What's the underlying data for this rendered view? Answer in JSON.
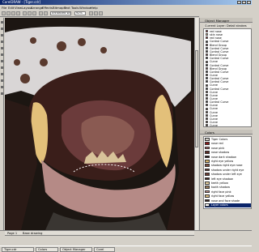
{
  "window": {
    "title": "CorelDRAW - [Tiger.cdr]"
  },
  "menu": [
    "File",
    "Edit",
    "View",
    "Layout",
    "Arrange",
    "Effects",
    "Bitmaps",
    "Text",
    "Tools",
    "Window",
    "Help"
  ],
  "property_bar": {
    "view_mode": "Enhanced Wire",
    "zoom": "92%"
  },
  "object_manager": {
    "title": "Object Manager",
    "layer_header": "Current Layer: Detail strokes",
    "items": [
      {
        "label": "red nose",
        "color": "#8b1a1a"
      },
      {
        "label": "skin nose",
        "color": "#c9a27e"
      },
      {
        "label": "red nose",
        "color": "#8b1a1a"
      },
      {
        "label": "Control Curve",
        "color": "#2a2a2a"
      },
      {
        "label": "Blend Group",
        "color": "#6b3b3b"
      },
      {
        "label": "Control Curve",
        "color": "#2a2a2a"
      },
      {
        "label": "Control Curve",
        "color": "#2a2a2a"
      },
      {
        "label": "Blend Group",
        "color": "#6b3b3b"
      },
      {
        "label": "Control Curve",
        "color": "#2a2a2a"
      },
      {
        "label": "Curve",
        "color": "#4a3226"
      },
      {
        "label": "Control Curve",
        "color": "#2a2a2a"
      },
      {
        "label": "Blend Group",
        "color": "#6b3b3b"
      },
      {
        "label": "Control Curve",
        "color": "#2a2a2a"
      },
      {
        "label": "Curve",
        "color": "#4a3226"
      },
      {
        "label": "Control Curve",
        "color": "#2a2a2a"
      },
      {
        "label": "Control Curve",
        "color": "#2a2a2a"
      },
      {
        "label": "Curve",
        "color": "#4a3226"
      },
      {
        "label": "Control Curve",
        "color": "#2a2a2a"
      },
      {
        "label": "Curve",
        "color": "#4a3226"
      },
      {
        "label": "Curve",
        "color": "#4a3226"
      },
      {
        "label": "Curve",
        "color": "#4a3226"
      },
      {
        "label": "Control Curve",
        "color": "#2a2a2a"
      },
      {
        "label": "Curve",
        "color": "#4a3226"
      },
      {
        "label": "Curve",
        "color": "#4a3226"
      },
      {
        "label": "Curve",
        "color": "#4a3226"
      },
      {
        "label": "Curve",
        "color": "#4a3226"
      },
      {
        "label": "Curve",
        "color": "#4a3226"
      },
      {
        "label": "Curve",
        "color": "#4a3226"
      },
      {
        "label": "Curve",
        "color": "#4a3226"
      }
    ]
  },
  "colors_panel": {
    "title": "Colors",
    "items": [
      {
        "label": "Tiger Colors",
        "color": "#d4d0c8"
      },
      {
        "label": "nose red",
        "color": "#8b1a1a"
      },
      {
        "label": "nose pink",
        "color": "#b46a6a"
      },
      {
        "label": "nose shadow",
        "color": "#5a2a22"
      },
      {
        "label": "nose dark shadow",
        "color": "#2a1612"
      },
      {
        "label": "right eye yellow",
        "color": "#d9b56a"
      },
      {
        "label": "shadow right eye nose",
        "color": "#7a4a3a"
      },
      {
        "label": "shadow under right eye",
        "color": "#6a3a30"
      },
      {
        "label": "shadow under left eye",
        "color": "#6a3a30"
      },
      {
        "label": "left eye shadow",
        "color": "#4a2a22"
      },
      {
        "label": "teeth yellow",
        "color": "#e8d2a0"
      },
      {
        "label": "tooth shadow",
        "color": "#9a7a58"
      },
      {
        "label": "right face pink",
        "color": "#c9928a"
      },
      {
        "label": "right face yellow",
        "color": "#e0c080"
      },
      {
        "label": "nose and face shade",
        "color": "#3a2420"
      },
      {
        "label": "Layer colors",
        "color": "#ffffff"
      }
    ]
  },
  "page_tabs": [
    "Page 1",
    "Base drawing"
  ],
  "taskbar": [
    "Tiger.cdr",
    "Colors",
    "Object Manager",
    "Corel"
  ],
  "illustration": {
    "background": "#1c1612",
    "mouth_dark": "#3a1e1a",
    "tongue": "#6b3b3b",
    "fur_white": "#d9d6d6",
    "tooth_yellow": "#e3c07a",
    "face_pink": "#b58a86",
    "spot_brown": "#5a3a2e"
  }
}
